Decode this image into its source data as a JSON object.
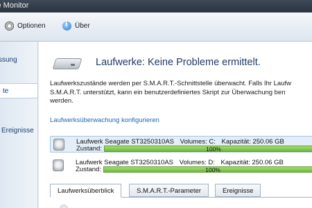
{
  "window": {
    "title": "ve Monitor"
  },
  "toolbar": {
    "options_label": "Optionen",
    "about_label": "Über"
  },
  "sidebar": {
    "items": [
      {
        "label": "ssung",
        "selected": false
      },
      {
        "label": "te",
        "selected": true
      },
      {
        "label": "Ereignisse",
        "selected": false
      }
    ]
  },
  "main": {
    "headline": "Laufwerke: Keine Probleme ermittelt.",
    "description": [
      "Laufwerkszustände werden per S.M.A.R.T.-Schnittstelle überwacht. Falls Ihr Laufw",
      "S.M.A.R.T. unterstützt, kann ein benutzerdefiniertes Skript zur Überwachung ben",
      "werden."
    ],
    "config_link": "Laufwerksüberwachung konfigurieren",
    "drives": [
      {
        "name": "Laufwerk Seagate ST3250310AS",
        "volumes": "Volumes: C:",
        "capacity": "Kapazität: 250.06 GB",
        "status_label": "Zustand:",
        "health": "100%",
        "selected": true
      },
      {
        "name": "Laufwerk Seagate ST3250310AS",
        "volumes": "Volumes: D:",
        "capacity": "Kapazität: 250.06 GB",
        "status_label": "Zustand:",
        "health": "100%",
        "selected": false
      }
    ],
    "tabs": [
      {
        "label": "Laufwerksüberblick",
        "active": true
      },
      {
        "label": "S.M.A.R.T.-Parameter",
        "active": false
      },
      {
        "label": "Ereignisse",
        "active": false
      }
    ]
  },
  "colors": {
    "health_bar": "#6dbb3a",
    "link": "#1f64b5",
    "headline": "#1f3b66"
  }
}
